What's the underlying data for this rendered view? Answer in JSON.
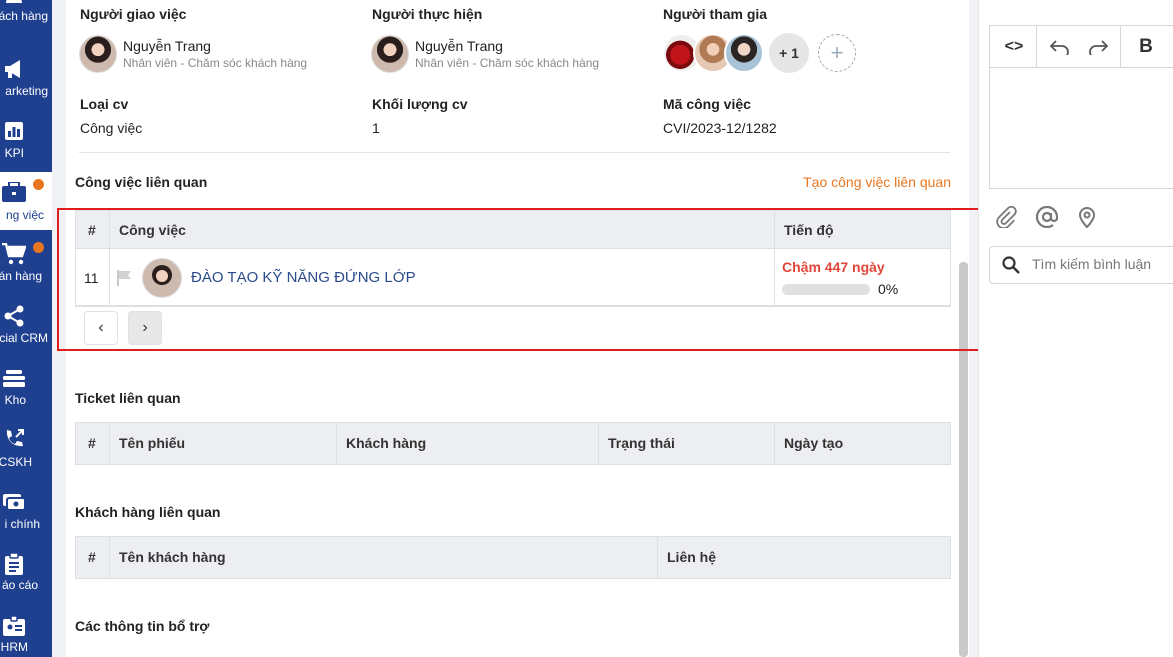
{
  "sidebar": {
    "items": [
      {
        "label": "ách hàng",
        "icon": "users-icon",
        "dot": true
      },
      {
        "label": "arketing",
        "icon": "megaphone-icon",
        "dot": false
      },
      {
        "label": "KPI",
        "icon": "kpi-chart-icon",
        "dot": false
      },
      {
        "label": "ng việc",
        "icon": "briefcase-icon",
        "dot": true,
        "active": true
      },
      {
        "label": "án hàng",
        "icon": "cart-icon",
        "dot": true
      },
      {
        "label": "cial CRM",
        "icon": "share-icon",
        "dot": false
      },
      {
        "label": "Kho",
        "icon": "warehouse-icon",
        "dot": false
      },
      {
        "label": "CSKH",
        "icon": "phone-forward-icon",
        "dot": false
      },
      {
        "label": "i chính",
        "icon": "money-icon",
        "dot": false
      },
      {
        "label": "áo cáo",
        "icon": "clipboard-icon",
        "dot": false
      },
      {
        "label": "HRM",
        "icon": "id-badge-icon",
        "dot": false
      }
    ]
  },
  "info": {
    "assigner_title": "Người giao việc",
    "assigner_name": "Nguyễn Trang",
    "assigner_role": "Nhân viên - Chăm sóc khách hàng",
    "executor_title": "Người thực hiện",
    "executor_name": "Nguyễn Trang",
    "executor_role": "Nhân viên - Chăm sóc khách hàng",
    "participants_title": "Người tham gia",
    "participants_more": "+ 1",
    "add_participant": "+",
    "type_title": "Loại cv",
    "type_value": "Công việc",
    "volume_title": "Khối lượng cv",
    "volume_value": "1",
    "code_title": "Mã công việc",
    "code_value": "CVI/2023-12/1282"
  },
  "related_tasks": {
    "title": "Công việc liên quan",
    "create_link": "Tạo công việc liên quan",
    "columns": [
      "#",
      "Công việc",
      "Tiến độ"
    ],
    "rows": [
      {
        "num": "11",
        "name": "ĐÀO TẠO KỸ NĂNG ĐỨNG LỚP",
        "status": "Chậm 447 ngày",
        "progress_value": 0,
        "progress": "0%"
      }
    ],
    "prev": "‹",
    "next": "›"
  },
  "tickets": {
    "title": "Ticket liên quan",
    "columns": [
      "#",
      "Tên phiếu",
      "Khách hàng",
      "Trạng thái",
      "Ngày tạo"
    ]
  },
  "customers": {
    "title": "Khách hàng liên quan",
    "columns": [
      "#",
      "Tên khách hàng",
      "Liên hệ"
    ]
  },
  "extra": {
    "title": "Các thông tin bổ trợ"
  },
  "comments": {
    "toolbar": {
      "code": "<>",
      "bold": "B"
    },
    "search_placeholder": "Tìm kiếm bình luận"
  },
  "colors": {
    "sidebar": "#1f3f8f",
    "accent_orange": "#e8761f",
    "late_red": "#e0463a",
    "link_blue": "#2b4a8c",
    "highlight_red": "#e01e1e"
  }
}
